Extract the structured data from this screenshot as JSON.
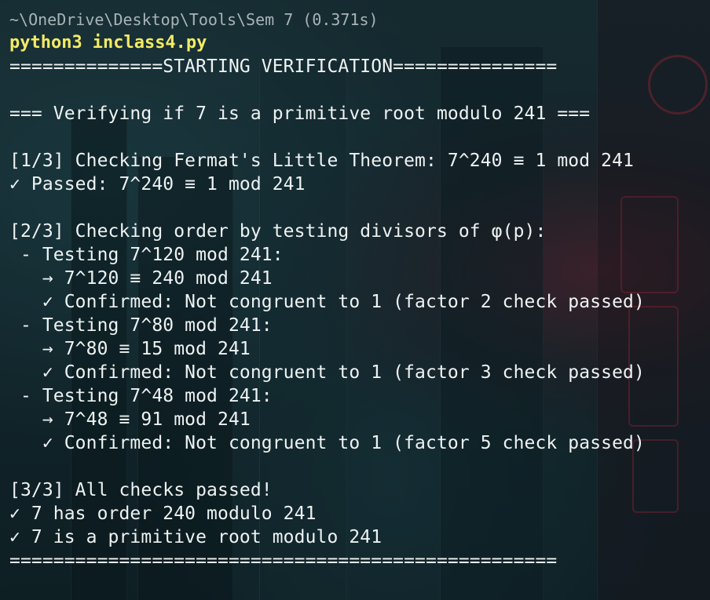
{
  "terminal": {
    "path_header": "~\\OneDrive\\Desktop\\Tools\\Sem 7 (0.371s)",
    "command": "python3",
    "command_arg": "inclass4.py",
    "lines": {
      "l01": "==============STARTING VERIFICATION===============",
      "l02": "=== Verifying if 7 is a primitive root modulo 241 ===",
      "l03": "[1/3] Checking Fermat's Little Theorem: 7^240 ≡ 1 mod 241",
      "l04": "✓ Passed: 7^240 ≡ 1 mod 241",
      "l05": "[2/3] Checking order by testing divisors of φ(p):",
      "l06": " - Testing 7^120 mod 241:",
      "l07": "   → 7^120 ≡ 240 mod 241",
      "l08": "   ✓ Confirmed: Not congruent to 1 (factor 2 check passed)",
      "l09": " - Testing 7^80 mod 241:",
      "l10": "   → 7^80 ≡ 15 mod 241",
      "l11": "   ✓ Confirmed: Not congruent to 1 (factor 3 check passed)",
      "l12": " - Testing 7^48 mod 241:",
      "l13": "   → 7^48 ≡ 91 mod 241",
      "l14": "   ✓ Confirmed: Not congruent to 1 (factor 5 check passed)",
      "l15": "[3/3] All checks passed!",
      "l16": "✓ 7 has order 240 modulo 241",
      "l17": "✓ 7 is a primitive root modulo 241",
      "l18": "=================================================="
    }
  },
  "colors": {
    "text": "#eef2f2",
    "command": "#f5ea64",
    "path": "#a9b4b6",
    "background": "#14272c"
  }
}
